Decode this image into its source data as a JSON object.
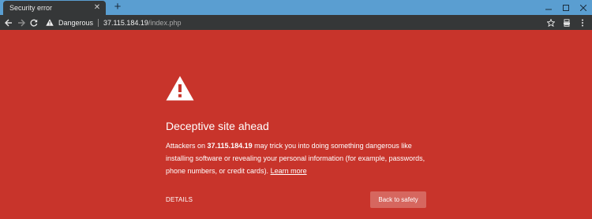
{
  "tab": {
    "title": "Security error",
    "close_glyph": "✕"
  },
  "new_tab_glyph": "+",
  "toolbar": {
    "security_label": "Dangerous",
    "url_host": "37.115.184.19",
    "url_path": "/index.php"
  },
  "interstitial": {
    "heading": "Deceptive site ahead",
    "message_prefix": "Attackers on ",
    "host": "37.115.184.19",
    "message_body": " may trick you into doing something dangerous like installing software or revealing your personal information (for example, passwords, phone numbers, or credit cards). ",
    "learn_more": "Learn more",
    "details_label": "DETAILS",
    "back_button": "Back to safety"
  },
  "colors": {
    "page_background": "#c8342b",
    "tabstrip": "#5a9ed1",
    "toolbar": "#353738",
    "button": "#d6675f"
  },
  "icons": [
    "close-icon",
    "minimize-icon",
    "maximize-icon",
    "back-arrow-icon",
    "forward-arrow-icon",
    "reload-icon",
    "warning-icon",
    "star-icon",
    "cast-icon",
    "menu-icon"
  ]
}
